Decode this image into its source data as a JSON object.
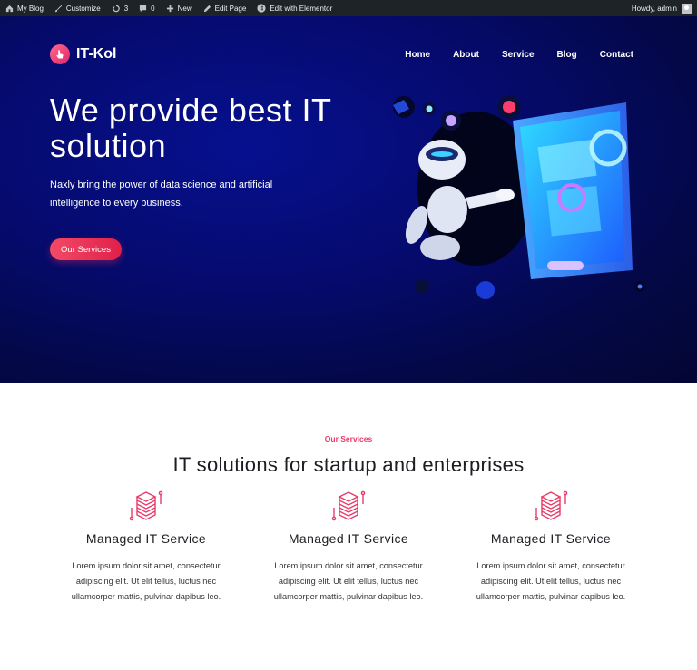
{
  "adminbar": {
    "items": [
      {
        "label": "My Blog",
        "icon": "house-icon"
      },
      {
        "label": "Customize",
        "icon": "brush-icon"
      },
      {
        "label": "3",
        "icon": "updates-icon"
      },
      {
        "label": "0",
        "icon": "comments-icon"
      },
      {
        "label": "New",
        "icon": "plus-icon"
      },
      {
        "label": "Edit Page",
        "icon": "pencil-icon"
      },
      {
        "label": "Edit with Elementor",
        "icon": "elementor-icon"
      }
    ],
    "greeting": "Howdy, admin"
  },
  "header": {
    "logo_text": "IT-Kol",
    "nav": [
      "Home",
      "About",
      "Service",
      "Blog",
      "Contact"
    ]
  },
  "hero": {
    "title": "We provide best IT solution",
    "subtitle": "Naxly bring the power of data science and artificial intelligence to every business.",
    "button": "Our Services"
  },
  "services": {
    "eyebrow": "Our Services",
    "title": "IT solutions for startup and enterprises",
    "cards": [
      {
        "title": "Managed IT Service",
        "text": "Lorem ipsum dolor sit amet, consectetur adipiscing elit. Ut elit tellus, luctus nec ullamcorper mattis, pulvinar dapibus leo.",
        "icon": "server-stack-icon"
      },
      {
        "title": "Managed IT Service",
        "text": "Lorem ipsum dolor sit amet, consectetur adipiscing elit. Ut elit tellus, luctus nec ullamcorper mattis, pulvinar dapibus leo.",
        "icon": "server-stack-icon"
      },
      {
        "title": "Managed IT Service",
        "text": "Lorem ipsum dolor sit amet, consectetur adipiscing elit. Ut elit tellus, luctus nec ullamcorper mattis, pulvinar dapibus leo.",
        "icon": "server-stack-icon"
      }
    ]
  },
  "colors": {
    "accent": "#e83a68",
    "hero_bg": "#050a6a",
    "adminbar": "#1d2327"
  }
}
